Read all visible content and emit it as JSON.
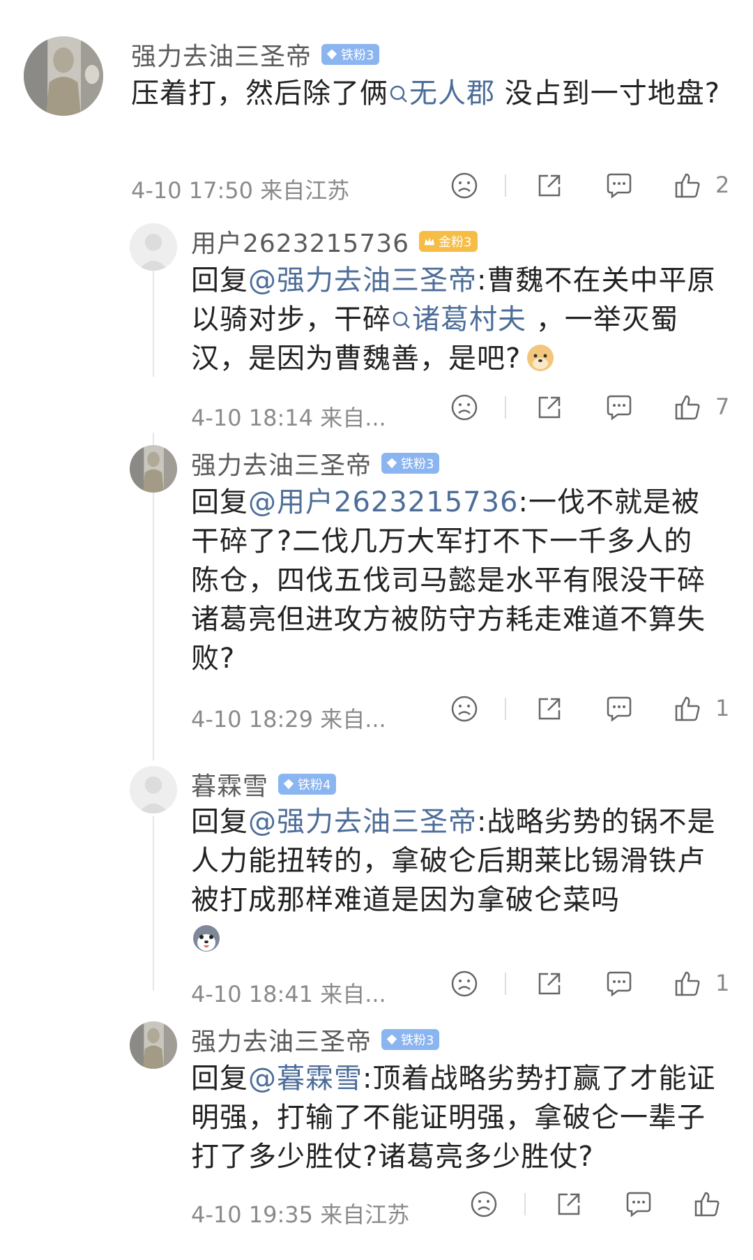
{
  "comments": [
    {
      "user": "强力去油三圣帝",
      "badge": "铁粉3",
      "text_before": "压着打，然后除了俩",
      "topic": "无人郡",
      "text_after": " 没占到一寸地盘?",
      "meta": "4-10 17:50 来自江苏",
      "likes": "2"
    },
    {
      "user": "用户2623215736",
      "badge": "金粉3",
      "reply_prefix": "回复",
      "mention": "@强力去油三圣帝",
      "text_before": ":曹魏不在关中平原以骑对步，干碎",
      "topic": "诸葛村夫",
      "text_after": " ，一举灭蜀汉，是因为曹魏善，是吧?",
      "meta": "4-10 18:14 来自...",
      "likes": "7"
    },
    {
      "user": "强力去油三圣帝",
      "badge": "铁粉3",
      "reply_prefix": "回复",
      "mention": "@用户2623215736",
      "text_after": ":一伐不就是被干碎了?二伐几万大军打不下一千多人的陈仓，四伐五伐司马懿是水平有限没干碎诸葛亮但进攻方被防守方耗走难道不算失败?",
      "meta": "4-10 18:29 来自...",
      "likes": "1"
    },
    {
      "user": "暮霖雪",
      "badge": "铁粉4",
      "reply_prefix": "回复",
      "mention": "@强力去油三圣帝",
      "text_after": ":战略劣势的锅不是人力能扭转的，拿破仑后期莱比锡滑铁卢被打成那样难道是因为拿破仑菜吗",
      "meta": "4-10 18:41 来自...",
      "likes": "1"
    },
    {
      "user": "强力去油三圣帝",
      "badge": "铁粉3",
      "reply_prefix": "回复",
      "mention": "@暮霖雪",
      "text_after": ":顶着战略劣势打赢了才能证明强，打输了不能证明强，拿破仑一辈子打了多少胜仗?诸葛亮多少胜仗?",
      "meta": "4-10 19:35 来自江苏",
      "likes": ""
    }
  ],
  "icons": {
    "dislike": "sad-face-icon",
    "share": "share-icon",
    "comment": "comment-bubble-icon",
    "like": "thumbs-up-icon",
    "topic": "search-icon"
  },
  "colors": {
    "link": "#4d6d99",
    "badge_iron": "#8bb5f0",
    "badge_gold": "#f5bd45",
    "meta": "#8a8a8a"
  }
}
